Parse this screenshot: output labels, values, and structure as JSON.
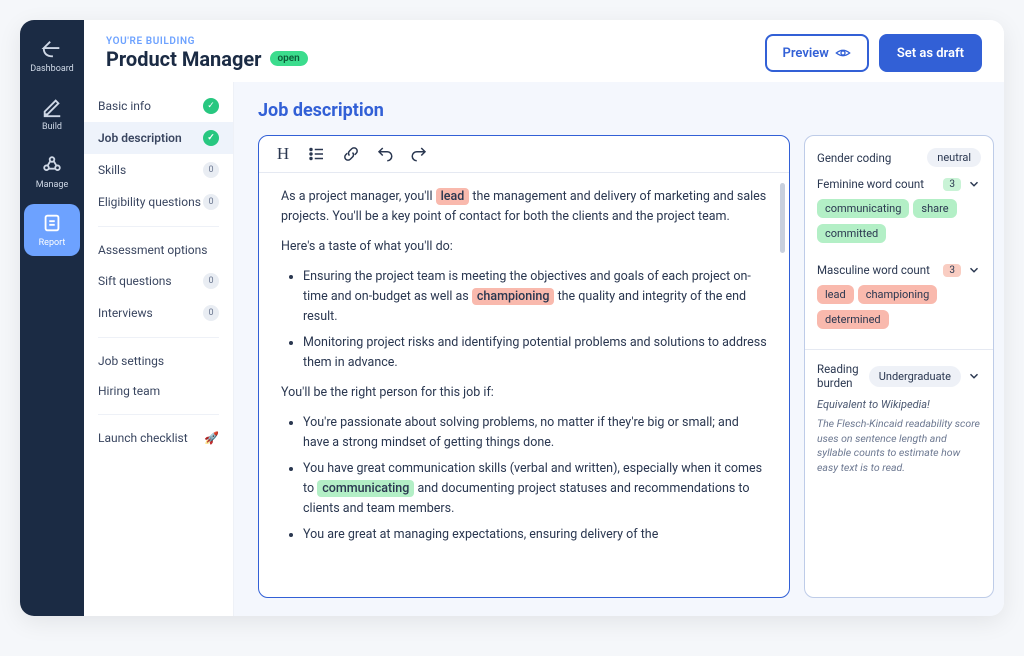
{
  "rail": [
    {
      "id": "dashboard",
      "label": "Dashboard"
    },
    {
      "id": "build",
      "label": "Build"
    },
    {
      "id": "manage",
      "label": "Manage"
    },
    {
      "id": "report",
      "label": "Report"
    }
  ],
  "header": {
    "eyebrow": "YOU'RE BUILDING",
    "title": "Product Manager",
    "status": "open",
    "preview": "Preview",
    "set_draft": "Set as draft"
  },
  "sidebar": {
    "groups": [
      [
        {
          "label": "Basic info",
          "type": "done"
        },
        {
          "label": "Job description",
          "type": "done",
          "active": true
        },
        {
          "label": "Skills",
          "type": "count",
          "count": 0
        },
        {
          "label": "Eligibility questions",
          "type": "count",
          "count": 0
        }
      ],
      [
        {
          "label": "Assessment options",
          "type": "none"
        },
        {
          "label": "Sift questions",
          "type": "count",
          "count": 0
        },
        {
          "label": "Interviews",
          "type": "count",
          "count": 0
        }
      ],
      [
        {
          "label": "Job settings",
          "type": "none"
        },
        {
          "label": "Hiring team",
          "type": "none"
        }
      ],
      [
        {
          "label": "Launch checklist",
          "type": "rocket"
        }
      ]
    ]
  },
  "content": {
    "heading": "Job description",
    "editor": {
      "p1_a": "As a project manager, you'll ",
      "p1_hl": "lead",
      "p1_b": " the management and delivery of marketing and sales projects. You'll be a key point of contact for both the clients and the project team.",
      "p2": "Here's a taste of what you'll do:",
      "li1_a": "Ensuring the project team is meeting the objectives and goals of each project on-time and on-budget as well as ",
      "li1_hl": "championing",
      "li1_b": " the quality and integrity of the end result.",
      "li2": "Monitoring project risks and identifying potential problems and solutions to address them in advance.",
      "p3": "You'll be the right person for this job if:",
      "li3": "You're passionate about solving problems, no matter if they're big or small; and have a strong mindset of getting things done.",
      "li4_a": "You have great communication skills (verbal and written), especially when it comes to ",
      "li4_hl": "communicating",
      "li4_b": " and documenting project statuses and recommendations to clients and team members.",
      "li5": "You are great at managing expectations, ensuring delivery of the"
    }
  },
  "analysis": {
    "gender_label": "Gender coding",
    "gender_value": "neutral",
    "fem_label": "Feminine word count",
    "fem_count": 3,
    "fem_words": [
      "communicating",
      "share",
      "committed"
    ],
    "mas_label": "Masculine word count",
    "mas_count": 3,
    "mas_words": [
      "lead",
      "championing",
      "determined"
    ],
    "reading_label": "Reading burden",
    "reading_value": "Undergraduate",
    "reading_equiv": "Equivalent to Wikipedia!",
    "reading_desc": "The Flesch-Kincaid readability score uses on sentence length and syllable counts to estimate how easy text is to read."
  }
}
